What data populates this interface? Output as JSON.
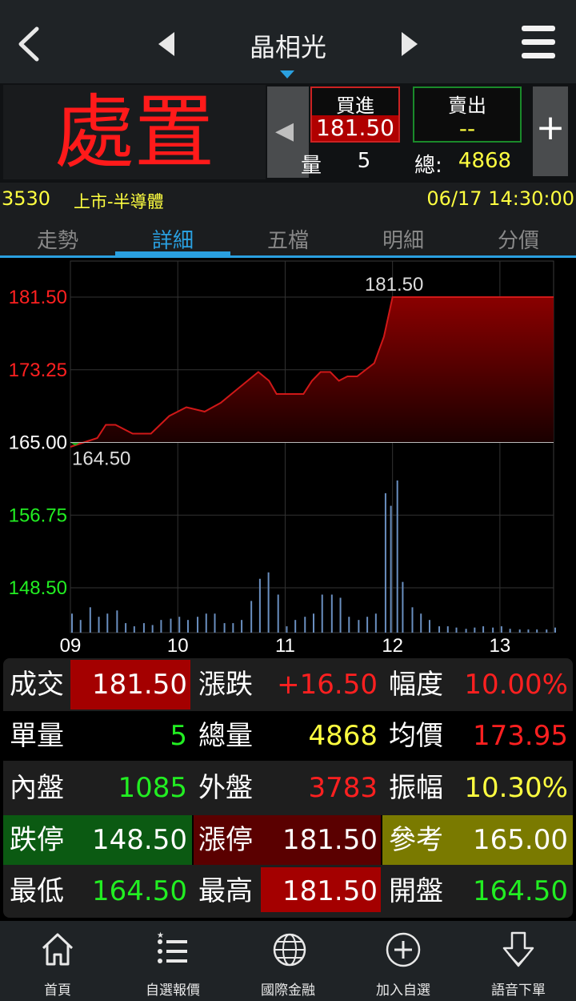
{
  "header": {
    "title": "晶相光",
    "back_icon": "chevron-left-icon",
    "prev_icon": "triangle-left-icon",
    "next_icon": "triangle-right-icon",
    "menu_icon": "hamburger-menu-icon"
  },
  "quote_panel": {
    "status": "處置",
    "bid_label": "買進",
    "bid_value": "181.50",
    "ask_label": "賣出",
    "ask_value": "--",
    "single_label_partial": "量:",
    "single_value": "5",
    "total_label": "總:",
    "total_value": "4868"
  },
  "stock_info": {
    "code": "3530",
    "market": "上市-半導體",
    "datetime": "06/17 14:30:00"
  },
  "tabs": [
    "走勢",
    "詳細",
    "五檔",
    "明細",
    "分價"
  ],
  "active_tab": 1,
  "chart_data": {
    "type": "area",
    "y_ticks": [
      "181.50",
      "173.25",
      "165.00",
      "156.75",
      "148.50"
    ],
    "x_ticks": [
      "09",
      "10",
      "11",
      "12",
      "13"
    ],
    "ylim": [
      148.5,
      181.5
    ],
    "reference": 165.0,
    "high_label": "181.50",
    "low_label": "164.50",
    "price": {
      "time": [
        9.0,
        9.25,
        9.33,
        9.42,
        9.58,
        9.75,
        9.92,
        10.08,
        10.25,
        10.4,
        10.55,
        10.75,
        10.85,
        10.92,
        11.0,
        11.17,
        11.25,
        11.33,
        11.42,
        11.5,
        11.58,
        11.67,
        11.83,
        11.92,
        12.0,
        12.5,
        13.5
      ],
      "values": [
        164.5,
        165.5,
        167.0,
        167.0,
        166.0,
        166.0,
        168.0,
        169.0,
        168.5,
        169.5,
        171.0,
        173.0,
        172.0,
        170.5,
        170.5,
        170.5,
        172.0,
        173.0,
        173.0,
        172.0,
        172.5,
        172.5,
        174.0,
        177.0,
        181.5,
        181.5,
        181.5
      ]
    },
    "volume": {
      "time": [
        9.0,
        9.08,
        9.17,
        9.25,
        9.33,
        9.42,
        9.5,
        9.58,
        9.67,
        9.75,
        9.83,
        9.92,
        10.0,
        10.08,
        10.17,
        10.25,
        10.33,
        10.42,
        10.5,
        10.58,
        10.67,
        10.75,
        10.83,
        10.92,
        11.0,
        11.08,
        11.17,
        11.25,
        11.33,
        11.42,
        11.5,
        11.58,
        11.67,
        11.75,
        11.83,
        11.92,
        11.97,
        12.03,
        12.08,
        12.17,
        12.25,
        12.33,
        12.42,
        12.5,
        12.58,
        12.67,
        12.75,
        12.83,
        12.92,
        13.0,
        13.08,
        13.17,
        13.25,
        13.33,
        13.42,
        13.5
      ],
      "values": [
        30,
        20,
        40,
        25,
        30,
        35,
        15,
        10,
        15,
        12,
        20,
        22,
        25,
        20,
        25,
        30,
        30,
        15,
        15,
        20,
        50,
        85,
        95,
        60,
        10,
        20,
        25,
        30,
        60,
        60,
        55,
        25,
        20,
        25,
        30,
        220,
        200,
        240,
        80,
        40,
        30,
        20,
        10,
        10,
        8,
        6,
        8,
        10,
        8,
        10,
        6,
        5,
        5,
        5,
        5,
        8
      ]
    }
  },
  "detail_table": {
    "rows": [
      [
        {
          "label": "成交",
          "value": "181.50"
        },
        {
          "label": "漲跌",
          "value": "+16.50"
        },
        {
          "label": "幅度",
          "value": "10.00%"
        }
      ],
      [
        {
          "label": "單量",
          "value": "5"
        },
        {
          "label": "總量",
          "value": "4868"
        },
        {
          "label": "均價",
          "value": "173.95"
        }
      ],
      [
        {
          "label": "內盤",
          "value": "1085"
        },
        {
          "label": "外盤",
          "value": "3783"
        },
        {
          "label": "振幅",
          "value": "10.30%"
        }
      ],
      [
        {
          "label": "跌停",
          "value": "148.50"
        },
        {
          "label": "漲停",
          "value": "181.50"
        },
        {
          "label": "參考",
          "value": "165.00"
        }
      ],
      [
        {
          "label": "最低",
          "value": "164.50"
        },
        {
          "label": "最高",
          "value": "181.50"
        },
        {
          "label": "開盤",
          "value": "164.50"
        }
      ]
    ]
  },
  "bottom_nav": [
    {
      "label": "首頁",
      "icon": "home-icon"
    },
    {
      "label": "自選報價",
      "icon": "list-star-icon"
    },
    {
      "label": "國際金融",
      "icon": "globe-icon"
    },
    {
      "label": "加入自選",
      "icon": "add-circle-icon"
    },
    {
      "label": "語音下單",
      "icon": "down-arrow-icon"
    }
  ],
  "colors": {
    "up": "#ff2020",
    "down": "#22ee22",
    "flat": "#ffff40",
    "accent": "#2aa0e0",
    "limit_down_bg": "#0b5a12",
    "limit_up_bg": "#5a0000",
    "reference_bg": "#7a7a00"
  }
}
